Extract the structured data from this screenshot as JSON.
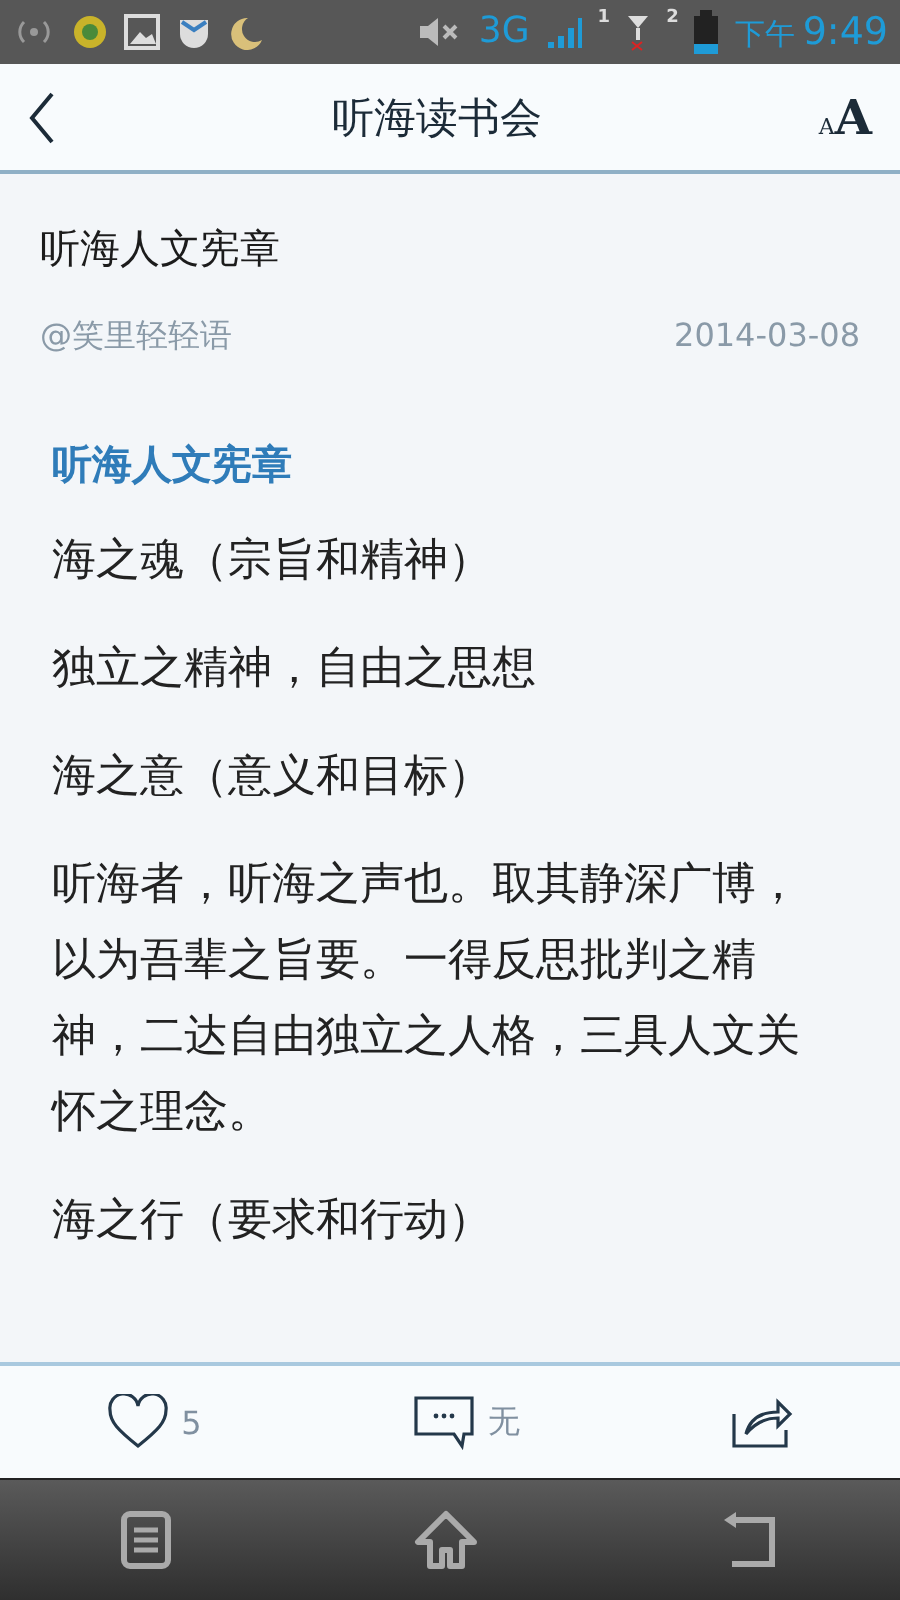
{
  "status_bar": {
    "network": "3G",
    "sim_1": "1",
    "sim_2": "2",
    "period": "下午",
    "time": "9:49"
  },
  "header": {
    "title": "听海读书会",
    "font_small": "A",
    "font_large": "A"
  },
  "article": {
    "title": "听海人文宪章",
    "author": "@笑里轻轻语",
    "date": "2014-03-08",
    "blocks": [
      {
        "kind": "heading",
        "text": "听海人文宪章"
      },
      {
        "kind": "paragraph",
        "text": "海之魂（宗旨和精神）"
      },
      {
        "kind": "paragraph",
        "text": "独立之精神，自由之思想"
      },
      {
        "kind": "paragraph",
        "text": "海之意（意义和目标）"
      },
      {
        "kind": "paragraph",
        "text": "听海者，听海之声也。取其静深广博，以为吾辈之旨要。一得反思批判之精神，二达自由独立之人格，三具人文关怀之理念。"
      },
      {
        "kind": "paragraph",
        "text": "海之行（要求和行动）"
      }
    ]
  },
  "actions": {
    "likes": "5",
    "comments": "无"
  }
}
